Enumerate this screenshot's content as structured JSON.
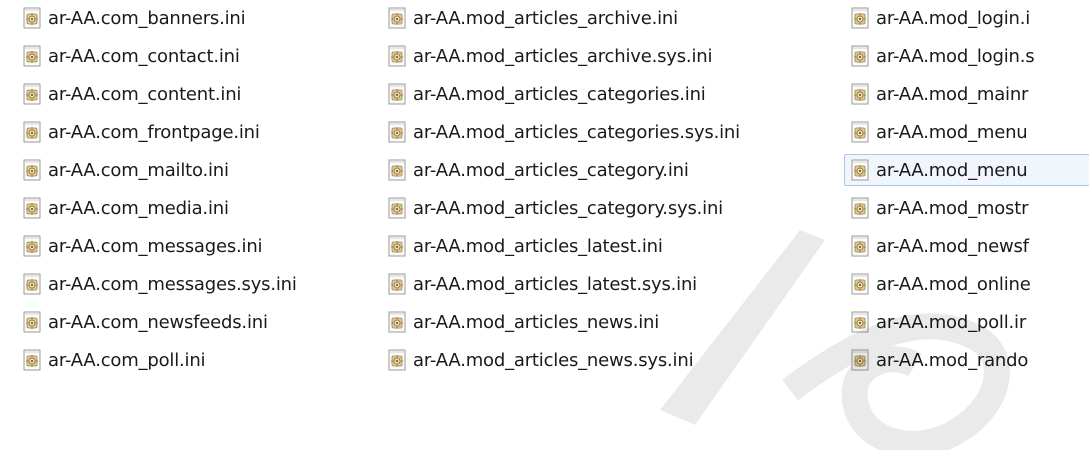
{
  "explorer": {
    "columns": [
      {
        "items": [
          {
            "name": "ar-AA.com_banners.ini",
            "icon": "ini-settings-file-icon"
          },
          {
            "name": "ar-AA.com_contact.ini",
            "icon": "ini-settings-file-icon"
          },
          {
            "name": "ar-AA.com_content.ini",
            "icon": "ini-settings-file-icon"
          },
          {
            "name": "ar-AA.com_frontpage.ini",
            "icon": "ini-settings-file-icon"
          },
          {
            "name": "ar-AA.com_mailto.ini",
            "icon": "ini-settings-file-icon"
          },
          {
            "name": "ar-AA.com_media.ini",
            "icon": "ini-settings-file-icon"
          },
          {
            "name": "ar-AA.com_messages.ini",
            "icon": "ini-settings-file-icon"
          },
          {
            "name": "ar-AA.com_messages.sys.ini",
            "icon": "ini-settings-file-icon"
          },
          {
            "name": "ar-AA.com_newsfeeds.ini",
            "icon": "ini-settings-file-icon"
          },
          {
            "name": "ar-AA.com_poll.ini",
            "icon": "ini-settings-file-icon"
          }
        ]
      },
      {
        "items": [
          {
            "name": "ar-AA.mod_articles_archive.ini",
            "icon": "ini-settings-file-icon"
          },
          {
            "name": "ar-AA.mod_articles_archive.sys.ini",
            "icon": "ini-settings-file-icon"
          },
          {
            "name": "ar-AA.mod_articles_categories.ini",
            "icon": "ini-settings-file-icon"
          },
          {
            "name": "ar-AA.mod_articles_categories.sys.ini",
            "icon": "ini-settings-file-icon"
          },
          {
            "name": "ar-AA.mod_articles_category.ini",
            "icon": "ini-settings-file-icon"
          },
          {
            "name": "ar-AA.mod_articles_category.sys.ini",
            "icon": "ini-settings-file-icon"
          },
          {
            "name": "ar-AA.mod_articles_latest.ini",
            "icon": "ini-settings-file-icon"
          },
          {
            "name": "ar-AA.mod_articles_latest.sys.ini",
            "icon": "ini-settings-file-icon"
          },
          {
            "name": "ar-AA.mod_articles_news.ini",
            "icon": "ini-settings-file-icon"
          },
          {
            "name": "ar-AA.mod_articles_news.sys.ini",
            "icon": "ini-settings-file-icon"
          }
        ]
      },
      {
        "items": [
          {
            "name": "ar-AA.mod_login.i",
            "icon": "ini-settings-file-icon"
          },
          {
            "name": "ar-AA.mod_login.s",
            "icon": "ini-settings-file-icon"
          },
          {
            "name": "ar-AA.mod_mainr",
            "icon": "ini-settings-file-icon"
          },
          {
            "name": "ar-AA.mod_menu",
            "icon": "ini-settings-file-icon"
          },
          {
            "name": "ar-AA.mod_menu",
            "icon": "ini-settings-file-icon",
            "selected": true
          },
          {
            "name": "ar-AA.mod_mostr",
            "icon": "ini-settings-file-icon"
          },
          {
            "name": "ar-AA.mod_newsf",
            "icon": "ini-settings-file-icon"
          },
          {
            "name": "ar-AA.mod_online",
            "icon": "ini-settings-file-icon"
          },
          {
            "name": "ar-AA.mod_poll.ir",
            "icon": "ini-settings-file-icon"
          },
          {
            "name": "ar-AA.mod_rando",
            "icon": "ini-settings-file-icon"
          }
        ]
      }
    ]
  },
  "colors": {
    "selection_bg": "#f1f6fd",
    "selection_border": "#a9c6ee",
    "text": "#1a1a1a"
  }
}
